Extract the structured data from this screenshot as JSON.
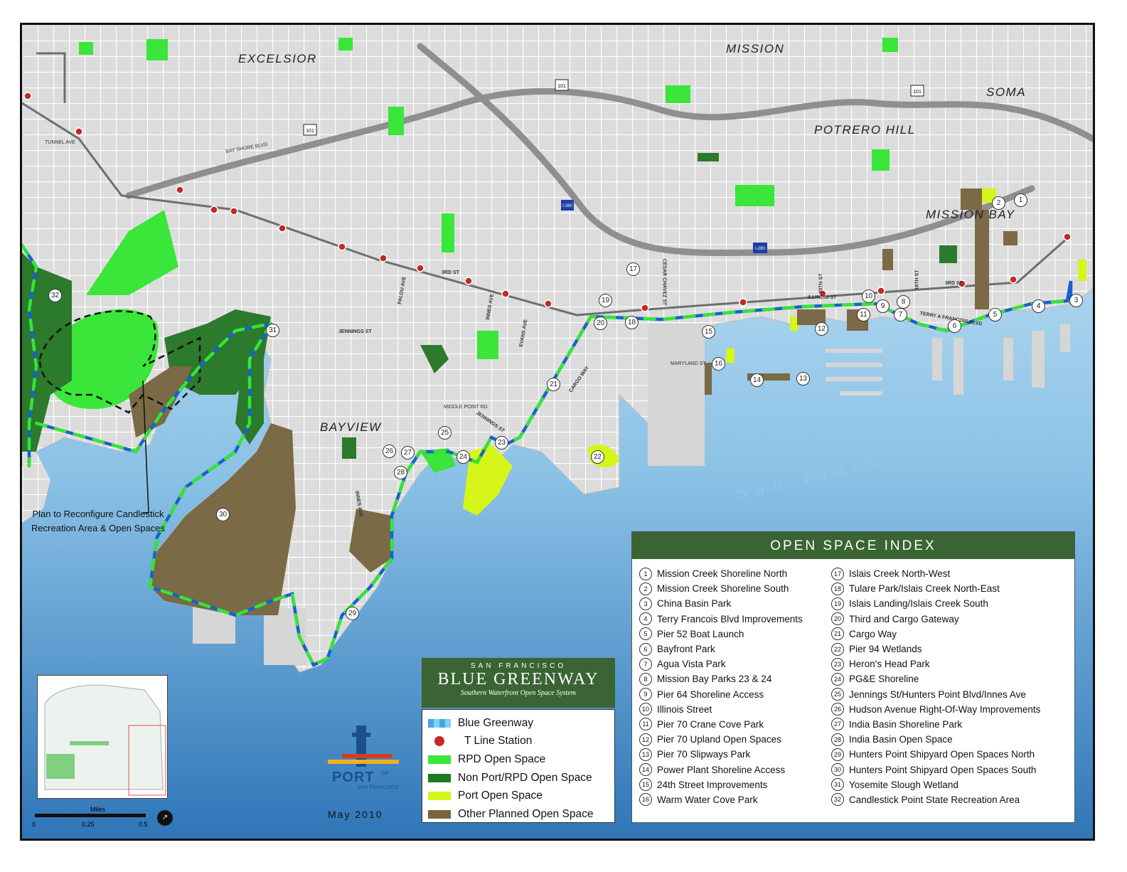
{
  "neighborhoods": {
    "excelsior": "EXCELSIOR",
    "mission": "MISSION",
    "soma": "SOMA",
    "potrero_hill": "POTRERO HILL",
    "mission_bay": "MISSION BAY",
    "bayview": "BAYVIEW"
  },
  "bay_name": "San Francisco Bay",
  "streets": {
    "third_st": "3RD ST",
    "illinois_st": "ILLINOIS ST",
    "cesar_chavez": "CESAR CHAVEZ ST",
    "cargo_way": "CARGO WAY",
    "jennings_st": "JENNINGS ST",
    "palou_ave": "PALOU AVE",
    "innes_ave": "INNES AVE",
    "evans_ave": "EVANS AVE",
    "terry_francois": "TERRY A FRANCOIS BLVD",
    "sixteenth_st": "16TH ST",
    "twentieth_st": "20TH ST",
    "maryland_st": "MARYLAND ST",
    "middle_point": "MIDDLE POINT RD",
    "tunnel_ave": "TUNNEL AVE",
    "bay_shore": "BAY SHORE BLVD",
    "hwy101": "101",
    "i280": "I-280"
  },
  "plan_note": "Plan to Reconfigure Candlestick Recreation Area & Open Spaces",
  "index": {
    "title": "OPEN SPACE INDEX",
    "items": [
      {
        "n": "1",
        "label": "Mission Creek Shoreline North"
      },
      {
        "n": "2",
        "label": "Mission Creek Shoreline South"
      },
      {
        "n": "3",
        "label": "China Basin Park"
      },
      {
        "n": "4",
        "label": "Terry Francois Blvd Improvements"
      },
      {
        "n": "5",
        "label": "Pier 52 Boat Launch"
      },
      {
        "n": "6",
        "label": "Bayfront Park"
      },
      {
        "n": "7",
        "label": "Agua Vista Park"
      },
      {
        "n": "8",
        "label": "Mission Bay Parks 23 & 24"
      },
      {
        "n": "9",
        "label": "Pier 64 Shoreline Access"
      },
      {
        "n": "10",
        "label": "Illinois Street"
      },
      {
        "n": "11",
        "label": "Pier 70 Crane Cove Park"
      },
      {
        "n": "12",
        "label": "Pier 70 Upland Open Spaces"
      },
      {
        "n": "13",
        "label": "Pier 70 Slipways Park"
      },
      {
        "n": "14",
        "label": "Power Plant Shoreline Access"
      },
      {
        "n": "15",
        "label": "24th Street Improvements"
      },
      {
        "n": "16",
        "label": "Warm Water Cove Park"
      },
      {
        "n": "17",
        "label": "Islais Creek North-West"
      },
      {
        "n": "18",
        "label": "Tulare Park/Islais Creek North-East"
      },
      {
        "n": "19",
        "label": "Islais Landing/Islais Creek South"
      },
      {
        "n": "20",
        "label": "Third and Cargo Gateway"
      },
      {
        "n": "21",
        "label": "Cargo Way"
      },
      {
        "n": "22",
        "label": "Pier 94 Wetlands"
      },
      {
        "n": "23",
        "label": "Heron's Head Park"
      },
      {
        "n": "24",
        "label": "PG&E Shoreline"
      },
      {
        "n": "25",
        "label": "Jennings St/Hunters Point Blvd/Innes Ave"
      },
      {
        "n": "26",
        "label": "Hudson Avenue Right-Of-Way Improvements"
      },
      {
        "n": "27",
        "label": "India Basin Shoreline Park"
      },
      {
        "n": "28",
        "label": "India Basin Open Space"
      },
      {
        "n": "29",
        "label": "Hunters Point Shipyard Open Spaces North"
      },
      {
        "n": "30",
        "label": "Hunters Point Shipyard Open Spaces South"
      },
      {
        "n": "31",
        "label": "Yosemite Slough Wetland"
      },
      {
        "n": "32",
        "label": "Candlestick Point State Recreation Area"
      }
    ]
  },
  "title_block": {
    "kicker": "SAN FRANCISCO",
    "name": "BLUE GREENWAY",
    "subtitle": "Southern Waterfront Open Space System"
  },
  "legend": [
    {
      "label": "Blue Greenway",
      "color": "#4aa3df"
    },
    {
      "label": "T Line Station",
      "color": "#c62828"
    },
    {
      "label": "RPD Open Space",
      "color": "#39e639"
    },
    {
      "label": "Non Port/RPD Open Space",
      "color": "#1f7a1f"
    },
    {
      "label": "Port Open Space",
      "color": "#d6f51a"
    },
    {
      "label": "Other Planned Open Space",
      "color": "#7a6440"
    }
  ],
  "port_logo": {
    "word": "PORT",
    "of": "OF",
    "city": "SAN FRANCISCO"
  },
  "date": "May 2010",
  "scale": {
    "unit": "Miles",
    "ticks": [
      "0",
      "0.25",
      "0.5"
    ]
  },
  "colors": {
    "land": "#e4e4e4",
    "water_top": "#cfe9f6",
    "water_bottom": "#2f76b8",
    "street": "#ffffff",
    "highway": "#9a9a9a",
    "greenway_blue": "#1a5fd0",
    "greenway_green": "#33e633",
    "rpd": "#39e639",
    "nonport": "#2c7a2c",
    "port": "#d6f51a",
    "planned": "#7a6a45"
  },
  "pins": [
    {
      "n": "1"
    },
    {
      "n": "2"
    },
    {
      "n": "3"
    },
    {
      "n": "4"
    },
    {
      "n": "5"
    },
    {
      "n": "6"
    },
    {
      "n": "7"
    },
    {
      "n": "8"
    },
    {
      "n": "9"
    },
    {
      "n": "10"
    },
    {
      "n": "11"
    },
    {
      "n": "12"
    },
    {
      "n": "13"
    },
    {
      "n": "14"
    },
    {
      "n": "15"
    },
    {
      "n": "16"
    },
    {
      "n": "17"
    },
    {
      "n": "18"
    },
    {
      "n": "19"
    },
    {
      "n": "20"
    },
    {
      "n": "21"
    },
    {
      "n": "22"
    },
    {
      "n": "23"
    },
    {
      "n": "24"
    },
    {
      "n": "25"
    },
    {
      "n": "26"
    },
    {
      "n": "27"
    },
    {
      "n": "28"
    },
    {
      "n": "29"
    },
    {
      "n": "30"
    },
    {
      "n": "31"
    },
    {
      "n": "32"
    }
  ]
}
